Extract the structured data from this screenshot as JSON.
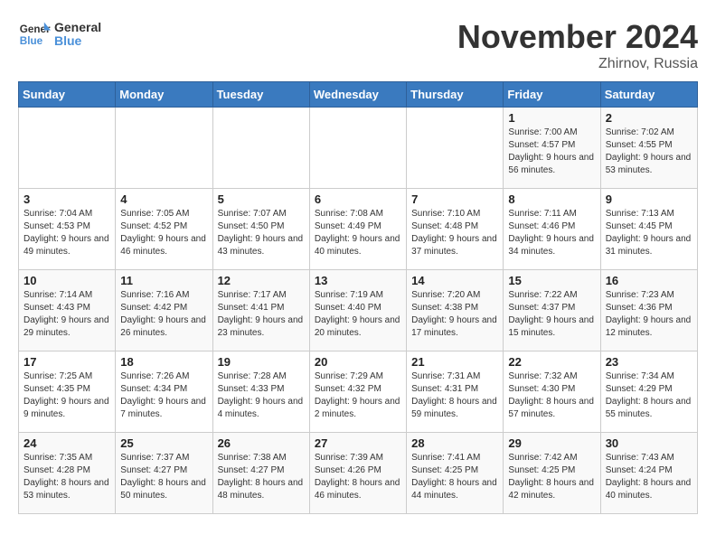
{
  "header": {
    "logo_general": "General",
    "logo_blue": "Blue",
    "month_title": "November 2024",
    "location": "Zhirnov, Russia"
  },
  "days_of_week": [
    "Sunday",
    "Monday",
    "Tuesday",
    "Wednesday",
    "Thursday",
    "Friday",
    "Saturday"
  ],
  "weeks": [
    [
      {
        "day": "",
        "info": ""
      },
      {
        "day": "",
        "info": ""
      },
      {
        "day": "",
        "info": ""
      },
      {
        "day": "",
        "info": ""
      },
      {
        "day": "",
        "info": ""
      },
      {
        "day": "1",
        "info": "Sunrise: 7:00 AM\nSunset: 4:57 PM\nDaylight: 9 hours and 56 minutes."
      },
      {
        "day": "2",
        "info": "Sunrise: 7:02 AM\nSunset: 4:55 PM\nDaylight: 9 hours and 53 minutes."
      }
    ],
    [
      {
        "day": "3",
        "info": "Sunrise: 7:04 AM\nSunset: 4:53 PM\nDaylight: 9 hours and 49 minutes."
      },
      {
        "day": "4",
        "info": "Sunrise: 7:05 AM\nSunset: 4:52 PM\nDaylight: 9 hours and 46 minutes."
      },
      {
        "day": "5",
        "info": "Sunrise: 7:07 AM\nSunset: 4:50 PM\nDaylight: 9 hours and 43 minutes."
      },
      {
        "day": "6",
        "info": "Sunrise: 7:08 AM\nSunset: 4:49 PM\nDaylight: 9 hours and 40 minutes."
      },
      {
        "day": "7",
        "info": "Sunrise: 7:10 AM\nSunset: 4:48 PM\nDaylight: 9 hours and 37 minutes."
      },
      {
        "day": "8",
        "info": "Sunrise: 7:11 AM\nSunset: 4:46 PM\nDaylight: 9 hours and 34 minutes."
      },
      {
        "day": "9",
        "info": "Sunrise: 7:13 AM\nSunset: 4:45 PM\nDaylight: 9 hours and 31 minutes."
      }
    ],
    [
      {
        "day": "10",
        "info": "Sunrise: 7:14 AM\nSunset: 4:43 PM\nDaylight: 9 hours and 29 minutes."
      },
      {
        "day": "11",
        "info": "Sunrise: 7:16 AM\nSunset: 4:42 PM\nDaylight: 9 hours and 26 minutes."
      },
      {
        "day": "12",
        "info": "Sunrise: 7:17 AM\nSunset: 4:41 PM\nDaylight: 9 hours and 23 minutes."
      },
      {
        "day": "13",
        "info": "Sunrise: 7:19 AM\nSunset: 4:40 PM\nDaylight: 9 hours and 20 minutes."
      },
      {
        "day": "14",
        "info": "Sunrise: 7:20 AM\nSunset: 4:38 PM\nDaylight: 9 hours and 17 minutes."
      },
      {
        "day": "15",
        "info": "Sunrise: 7:22 AM\nSunset: 4:37 PM\nDaylight: 9 hours and 15 minutes."
      },
      {
        "day": "16",
        "info": "Sunrise: 7:23 AM\nSunset: 4:36 PM\nDaylight: 9 hours and 12 minutes."
      }
    ],
    [
      {
        "day": "17",
        "info": "Sunrise: 7:25 AM\nSunset: 4:35 PM\nDaylight: 9 hours and 9 minutes."
      },
      {
        "day": "18",
        "info": "Sunrise: 7:26 AM\nSunset: 4:34 PM\nDaylight: 9 hours and 7 minutes."
      },
      {
        "day": "19",
        "info": "Sunrise: 7:28 AM\nSunset: 4:33 PM\nDaylight: 9 hours and 4 minutes."
      },
      {
        "day": "20",
        "info": "Sunrise: 7:29 AM\nSunset: 4:32 PM\nDaylight: 9 hours and 2 minutes."
      },
      {
        "day": "21",
        "info": "Sunrise: 7:31 AM\nSunset: 4:31 PM\nDaylight: 8 hours and 59 minutes."
      },
      {
        "day": "22",
        "info": "Sunrise: 7:32 AM\nSunset: 4:30 PM\nDaylight: 8 hours and 57 minutes."
      },
      {
        "day": "23",
        "info": "Sunrise: 7:34 AM\nSunset: 4:29 PM\nDaylight: 8 hours and 55 minutes."
      }
    ],
    [
      {
        "day": "24",
        "info": "Sunrise: 7:35 AM\nSunset: 4:28 PM\nDaylight: 8 hours and 53 minutes."
      },
      {
        "day": "25",
        "info": "Sunrise: 7:37 AM\nSunset: 4:27 PM\nDaylight: 8 hours and 50 minutes."
      },
      {
        "day": "26",
        "info": "Sunrise: 7:38 AM\nSunset: 4:27 PM\nDaylight: 8 hours and 48 minutes."
      },
      {
        "day": "27",
        "info": "Sunrise: 7:39 AM\nSunset: 4:26 PM\nDaylight: 8 hours and 46 minutes."
      },
      {
        "day": "28",
        "info": "Sunrise: 7:41 AM\nSunset: 4:25 PM\nDaylight: 8 hours and 44 minutes."
      },
      {
        "day": "29",
        "info": "Sunrise: 7:42 AM\nSunset: 4:25 PM\nDaylight: 8 hours and 42 minutes."
      },
      {
        "day": "30",
        "info": "Sunrise: 7:43 AM\nSunset: 4:24 PM\nDaylight: 8 hours and 40 minutes."
      }
    ]
  ]
}
